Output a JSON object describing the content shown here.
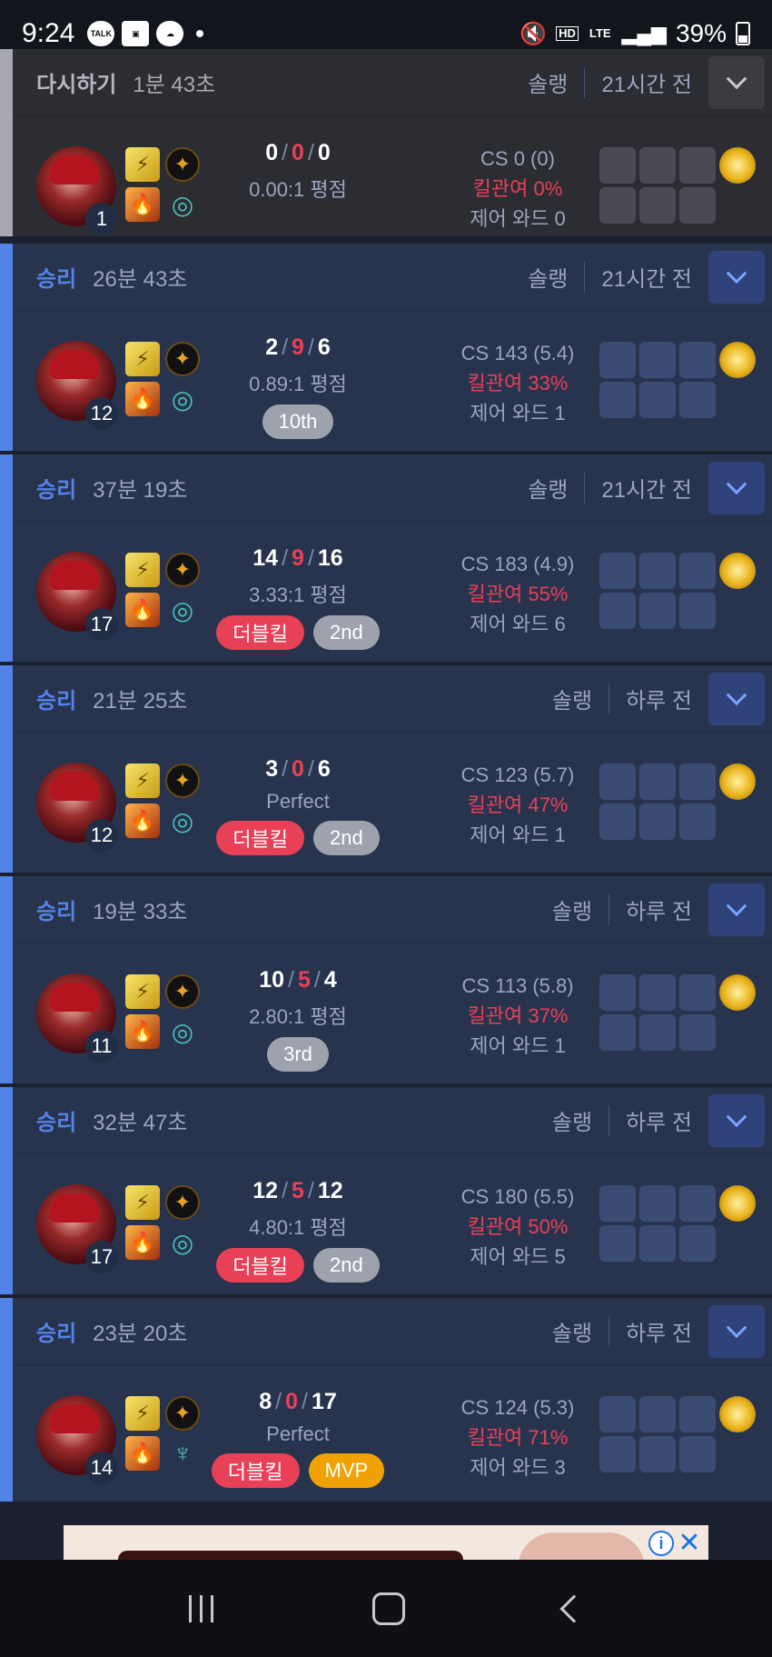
{
  "status_bar": {
    "time": "9:24",
    "talk_icon": "TALK",
    "battery_text": "39%",
    "hd_label": "HD",
    "lte_label": "LTE"
  },
  "matches": [
    {
      "result": "다시하기",
      "duration": "1분 43초",
      "queue": "솔랭",
      "when": "21시간 전",
      "level": "1",
      "kills": "0",
      "deaths": "0",
      "assists": "0",
      "ratio": "0.00:1 평점",
      "cs": "CS 0 (0)",
      "kill_participation": "킬관여 0%",
      "wards": "제어 와드 0",
      "badges": []
    },
    {
      "result": "승리",
      "duration": "26분 43초",
      "queue": "솔랭",
      "when": "21시간 전",
      "level": "12",
      "kills": "2",
      "deaths": "9",
      "assists": "6",
      "ratio": "0.89:1 평점",
      "cs": "CS 143 (5.4)",
      "kill_participation": "킬관여 33%",
      "wards": "제어 와드 1",
      "badges": [
        {
          "text": "10th",
          "kind": "rank"
        }
      ]
    },
    {
      "result": "승리",
      "duration": "37분 19초",
      "queue": "솔랭",
      "when": "21시간 전",
      "level": "17",
      "kills": "14",
      "deaths": "9",
      "assists": "16",
      "ratio": "3.33:1 평점",
      "cs": "CS 183 (4.9)",
      "kill_participation": "킬관여 55%",
      "wards": "제어 와드 6",
      "badges": [
        {
          "text": "더블킬",
          "kind": "mk"
        },
        {
          "text": "2nd",
          "kind": "rank"
        }
      ]
    },
    {
      "result": "승리",
      "duration": "21분 25초",
      "queue": "솔랭",
      "when": "하루 전",
      "level": "12",
      "kills": "3",
      "deaths": "0",
      "assists": "6",
      "ratio": "Perfect",
      "cs": "CS 123 (5.7)",
      "kill_participation": "킬관여 47%",
      "wards": "제어 와드 1",
      "badges": [
        {
          "text": "더블킬",
          "kind": "mk"
        },
        {
          "text": "2nd",
          "kind": "rank"
        }
      ]
    },
    {
      "result": "승리",
      "duration": "19분 33초",
      "queue": "솔랭",
      "when": "하루 전",
      "level": "11",
      "kills": "10",
      "deaths": "5",
      "assists": "4",
      "ratio": "2.80:1 평점",
      "cs": "CS 113 (5.8)",
      "kill_participation": "킬관여 37%",
      "wards": "제어 와드 1",
      "badges": [
        {
          "text": "3rd",
          "kind": "rank"
        }
      ]
    },
    {
      "result": "승리",
      "duration": "32분 47초",
      "queue": "솔랭",
      "when": "하루 전",
      "level": "17",
      "kills": "12",
      "deaths": "5",
      "assists": "12",
      "ratio": "4.80:1 평점",
      "cs": "CS 180 (5.5)",
      "kill_participation": "킬관여 50%",
      "wards": "제어 와드 5",
      "badges": [
        {
          "text": "더블킬",
          "kind": "mk"
        },
        {
          "text": "2nd",
          "kind": "rank"
        }
      ]
    },
    {
      "result": "승리",
      "duration": "23분 20초",
      "queue": "솔랭",
      "when": "하루 전",
      "level": "14",
      "kills": "8",
      "deaths": "0",
      "assists": "17",
      "ratio": "Perfect",
      "cs": "CS 124 (5.3)",
      "kill_participation": "킬관여 71%",
      "wards": "제어 와드 3",
      "badges": [
        {
          "text": "더블킬",
          "kind": "mk"
        },
        {
          "text": "MVP",
          "kind": "mvp"
        }
      ]
    }
  ],
  "ad": {
    "info_label": "i",
    "close_label": "✕"
  }
}
